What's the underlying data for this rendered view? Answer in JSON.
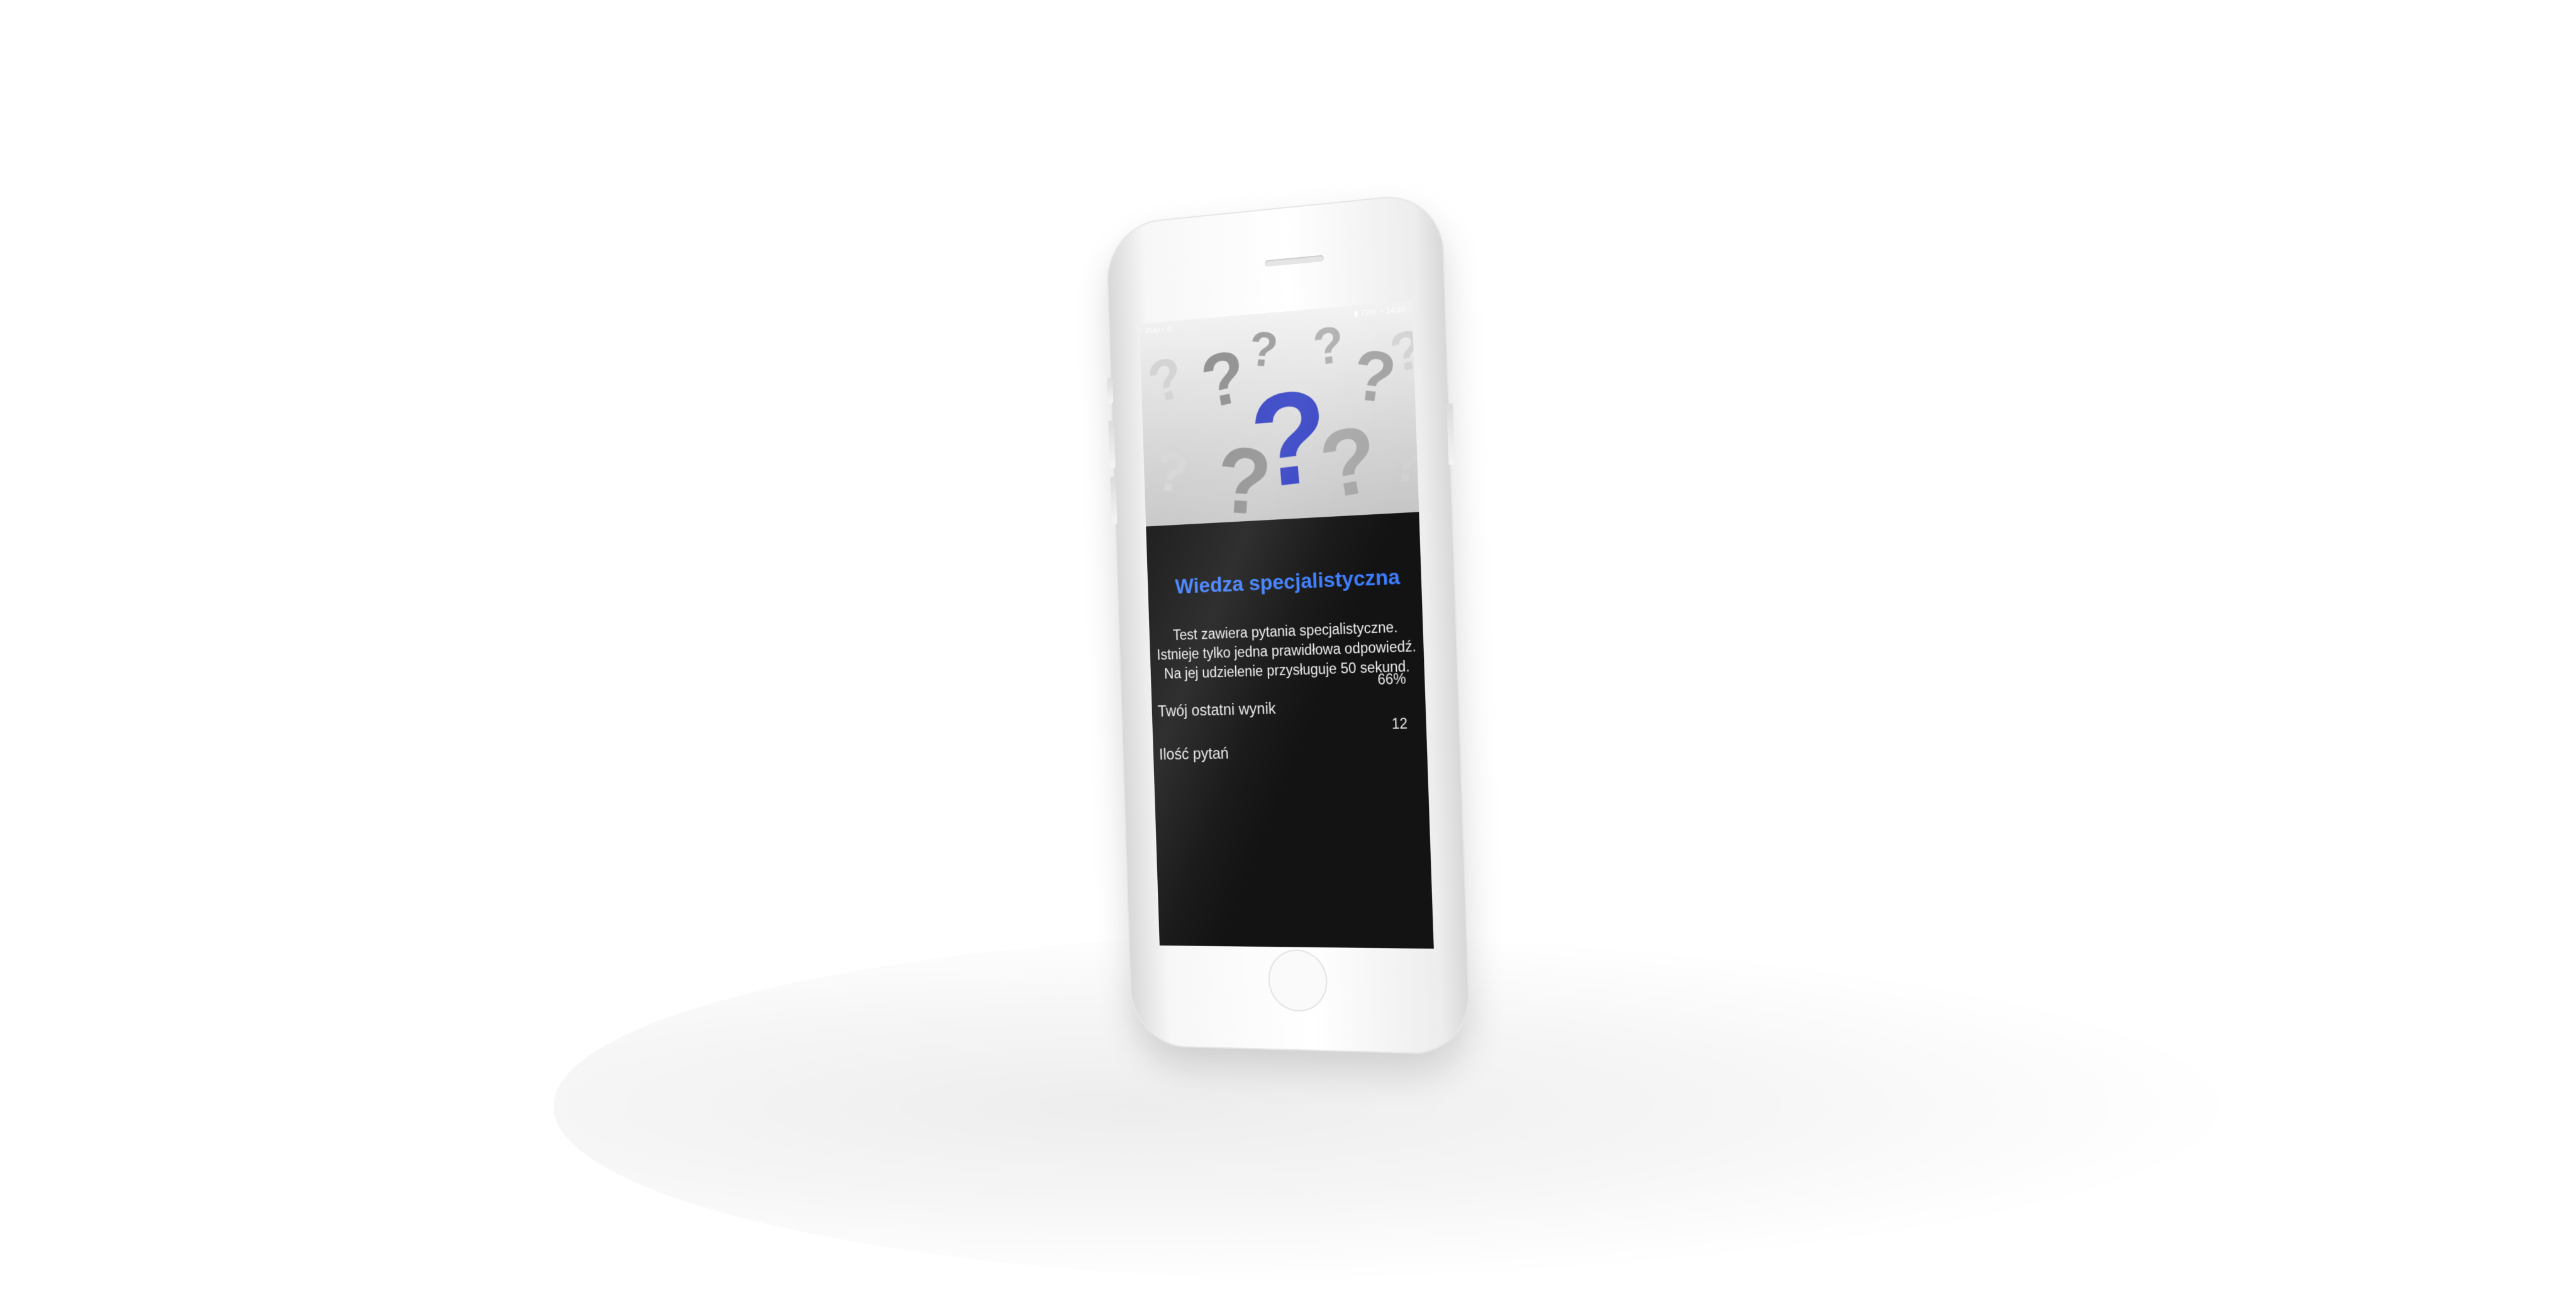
{
  "status_bar": {
    "left": "Play ◦ ✆",
    "right": "▮ 79% ◔ 14:45"
  },
  "hero": {
    "background_color": "#d6d6d6",
    "accent_symbol": "?",
    "accent_color": "#2e3cc2",
    "decorative_symbol": "?"
  },
  "quiz": {
    "title": "Wiedza specjalistyczna",
    "description": "Test zawiera pytania specjalistyczne. Istnieje tylko jedna prawidłowa odpowiedź. Na jej udzielenie przysługuje 50 sekund.",
    "stats": [
      {
        "label": "Twój ostatni wynik",
        "value": "66%"
      },
      {
        "label": "Ilość pytań",
        "value": "12"
      }
    ]
  }
}
